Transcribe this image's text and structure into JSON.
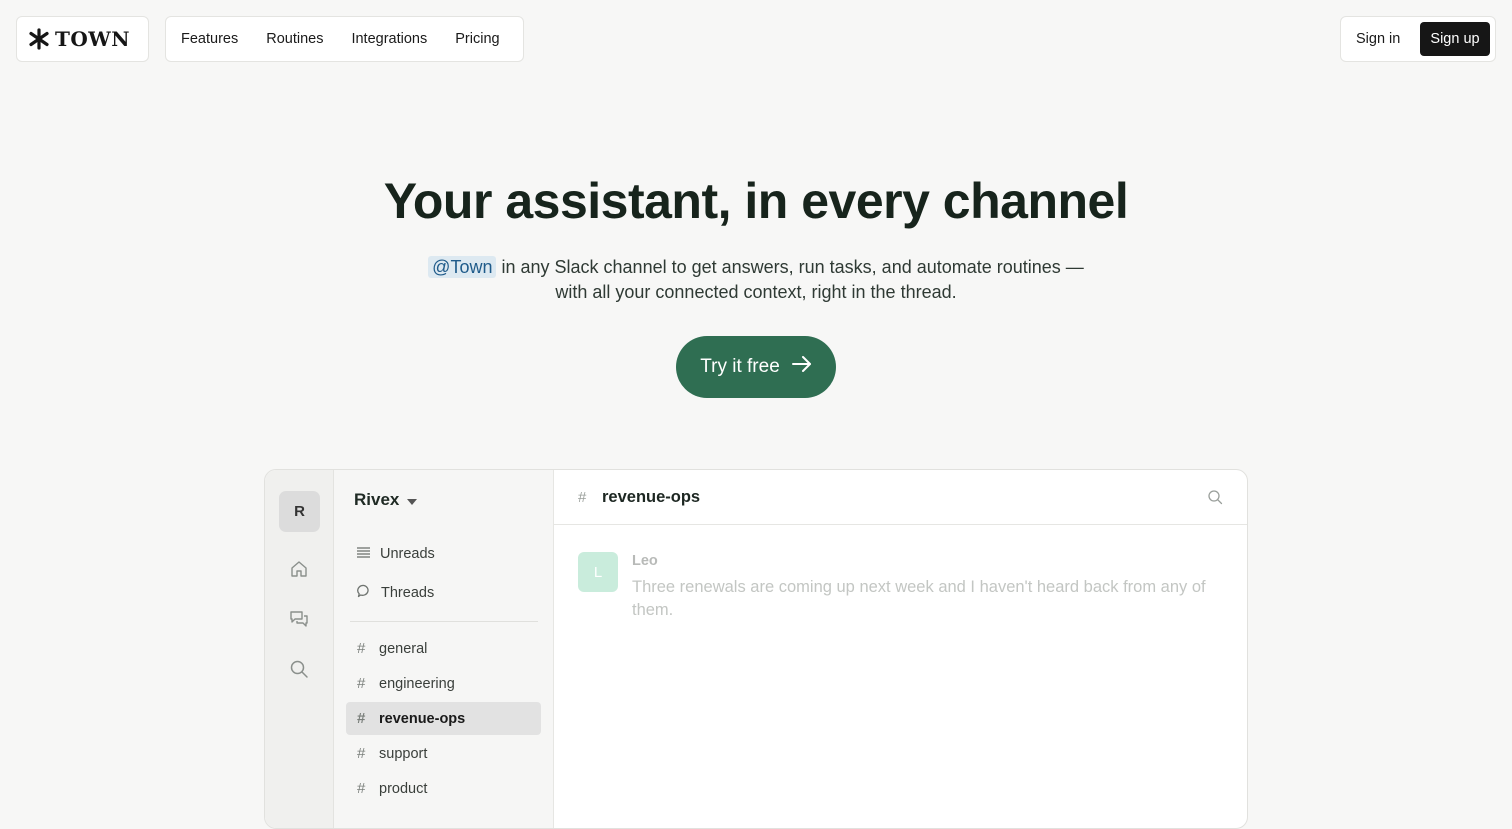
{
  "brand": {
    "name": "TOWN"
  },
  "nav": {
    "links": [
      "Features",
      "Routines",
      "Integrations",
      "Pricing"
    ]
  },
  "auth": {
    "sign_in": "Sign in",
    "sign_up": "Sign up"
  },
  "hero": {
    "title": "Your assistant, in every channel",
    "mention": "@Town",
    "subtitle_line1_rest": "in any Slack channel to get answers, run tasks, and automate routines —",
    "subtitle_line2": "with all your connected context, right in the thread.",
    "cta_label": "Try it free"
  },
  "app": {
    "workspace_initial": "R",
    "workspace_name": "Rivex",
    "rail_icons": [
      "home-icon",
      "messages-icon",
      "search-icon"
    ],
    "sidebar": {
      "unreads": "Unreads",
      "threads": "Threads",
      "channels": [
        "general",
        "engineering",
        "revenue-ops",
        "support",
        "product"
      ],
      "active_channel": "revenue-ops"
    },
    "channel": {
      "name": "revenue-ops",
      "message": {
        "author_initial": "L",
        "author": "Leo",
        "text": "Three renewals are coming up next week and I haven't heard back from any of them."
      }
    }
  },
  "colors": {
    "background": "#f7f7f6",
    "cta": "#2f6e52",
    "signup_bg": "#161616",
    "mention_bg": "#dde9f1",
    "mention_text": "#1f5b8a"
  }
}
